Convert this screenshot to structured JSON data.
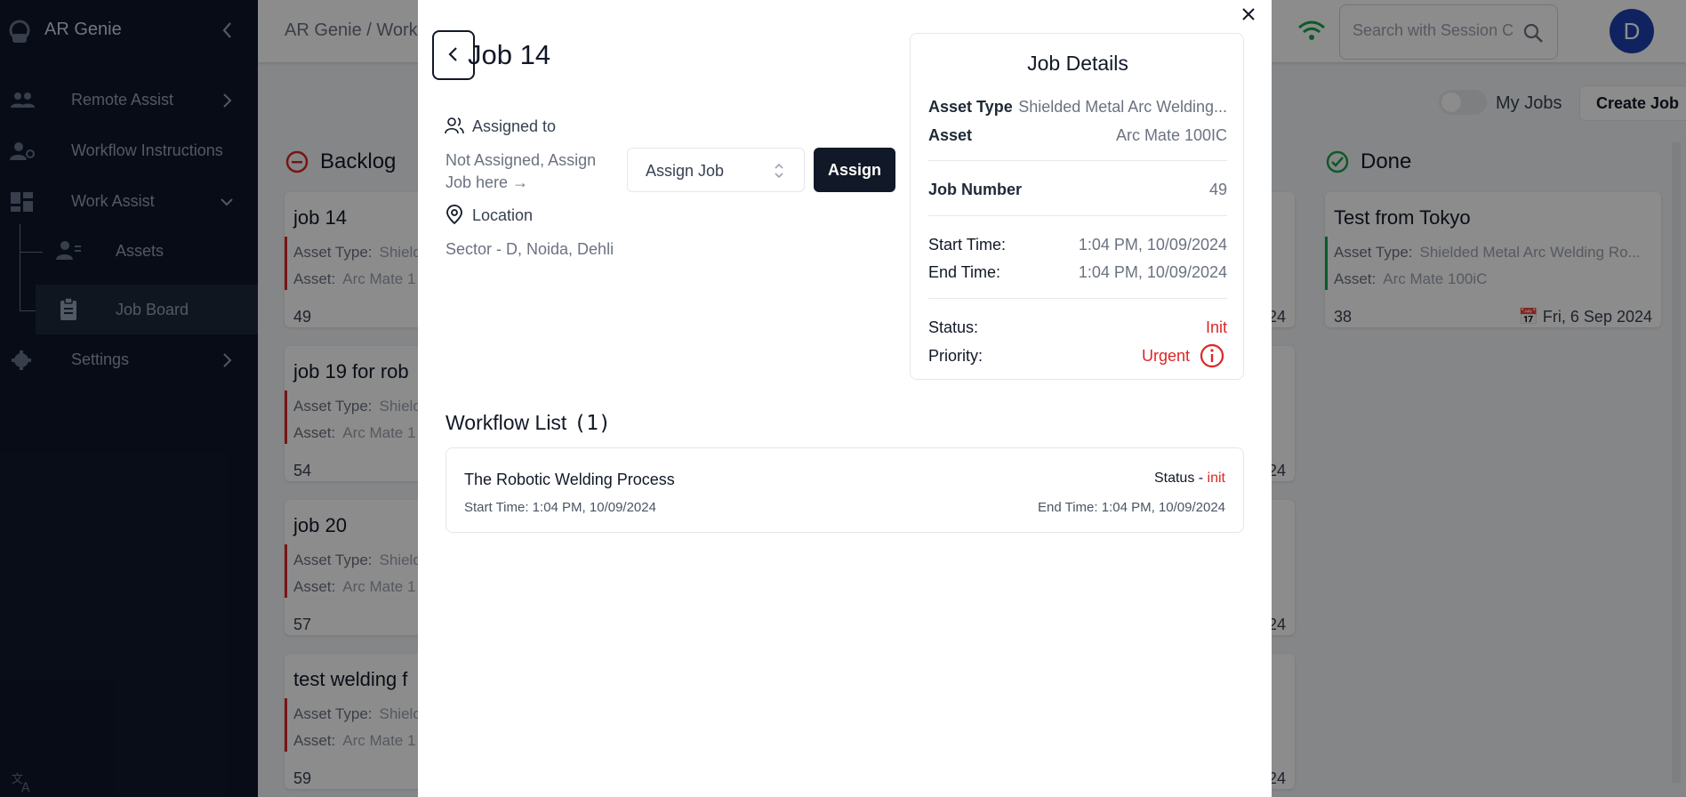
{
  "app": {
    "name": "AR Genie"
  },
  "sidebar": {
    "items": [
      {
        "label": "Remote Assist"
      },
      {
        "label": "Workflow Instructions"
      },
      {
        "label": "Work Assist"
      },
      {
        "label": "Assets"
      },
      {
        "label": "Job Board"
      },
      {
        "label": "Settings"
      }
    ]
  },
  "topbar": {
    "breadcrumb": "AR Genie  /  Work",
    "search_placeholder": "Search with Session Code",
    "avatar_initial": "D"
  },
  "board": {
    "my_jobs_label": "My Jobs",
    "create_job_label": "Create Job",
    "backlog_title": "Backlog",
    "done_title": "Done",
    "backlog_cards": [
      {
        "title": "job 14",
        "asset_type_label": "Asset Type:",
        "asset_type": "Shield",
        "asset_label": "Asset:",
        "asset": "Arc Mate 1",
        "number": "49"
      },
      {
        "title": "job 19 for rob",
        "asset_type_label": "Asset Type:",
        "asset_type": "Shield",
        "asset_label": "Asset:",
        "asset": "Arc Mate 1",
        "number": "54"
      },
      {
        "title": "job 20",
        "asset_type_label": "Asset Type:",
        "asset_type": "Shield",
        "asset_label": "Asset:",
        "asset": "Arc Mate 1",
        "number": "57"
      },
      {
        "title": "test welding f",
        "asset_type_label": "Asset Type:",
        "asset_type": "Shield",
        "asset_label": "Asset:",
        "asset": "Arc Mate 1",
        "number": "59"
      }
    ],
    "partial_dates": [
      "24",
      "24",
      "24",
      "24"
    ],
    "done_cards": [
      {
        "title": "Test from Tokyo",
        "asset_type_label": "Asset Type:",
        "asset_type": "Shielded Metal Arc Welding Ro...",
        "asset_label": "Asset:",
        "asset": "Arc Mate 100iC",
        "number": "38",
        "date": "Fri, 6 Sep 2024"
      }
    ]
  },
  "modal": {
    "title": "Job 14",
    "assigned_label": "Assigned to",
    "not_assigned_text": "Not Assigned, Assign Job here →",
    "assign_select_value": "Assign Job",
    "assign_button": "Assign",
    "location_label": "Location",
    "location_value": "Sector - D, Noida, Dehli",
    "details": {
      "title": "Job Details",
      "asset_type_label": "Asset Type",
      "asset_type": "Shielded Metal Arc Welding...",
      "asset_label": "Asset",
      "asset": "Arc Mate 100IC",
      "job_number_label": "Job Number",
      "job_number": "49",
      "start_label": "Start Time:",
      "start": "1:04 PM, 10/09/2024",
      "end_label": "End Time:",
      "end": "1:04 PM, 10/09/2024",
      "status_label": "Status:",
      "status": "Init",
      "priority_label": "Priority:",
      "priority": "Urgent"
    },
    "workflow": {
      "title": "Workflow List",
      "count": "(1)",
      "items": [
        {
          "name": "The Robotic Welding Process",
          "status_label": "Status - ",
          "status": "init",
          "start": "Start Time: 1:04 PM, 10/09/2024",
          "end": "End Time: 1:04 PM, 10/09/2024"
        }
      ]
    }
  },
  "colors": {
    "sidebar_bg": "#0f172a",
    "urgent": "#dc2626",
    "done": "#16a34a",
    "primary": "#111827"
  }
}
